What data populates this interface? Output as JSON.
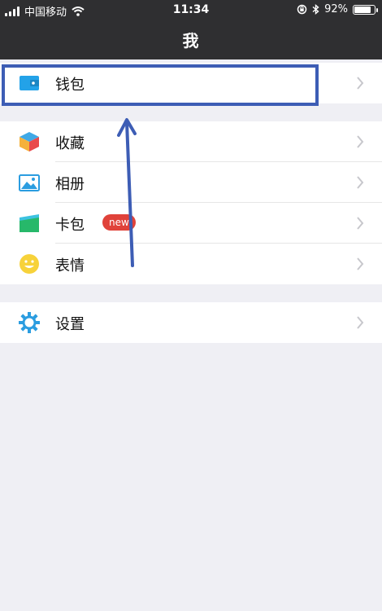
{
  "status_bar": {
    "carrier": "中国移动",
    "time": "11:34",
    "battery_percent": "92%",
    "battery_level": 0.92,
    "icons": [
      "signal-icon",
      "wifi-icon",
      "rotation-lock-icon",
      "bluetooth-icon",
      "battery-icon"
    ]
  },
  "nav": {
    "title": "我"
  },
  "menu": {
    "wallet": {
      "label": "钱包",
      "icon": "wallet-icon"
    },
    "items": [
      {
        "label": "收藏",
        "icon": "favorites-cube-icon"
      },
      {
        "label": "相册",
        "icon": "album-image-icon"
      },
      {
        "label": "卡包",
        "icon": "card-package-icon",
        "badge": "new"
      },
      {
        "label": "表情",
        "icon": "emoji-smile-icon"
      }
    ],
    "settings": {
      "label": "设置",
      "icon": "settings-gear-icon"
    }
  },
  "colors": {
    "header_bg": "#2f2f31",
    "page_bg": "#efeff4",
    "annotation_blue": "#3d5db5",
    "badge_red": "#e0423a"
  }
}
